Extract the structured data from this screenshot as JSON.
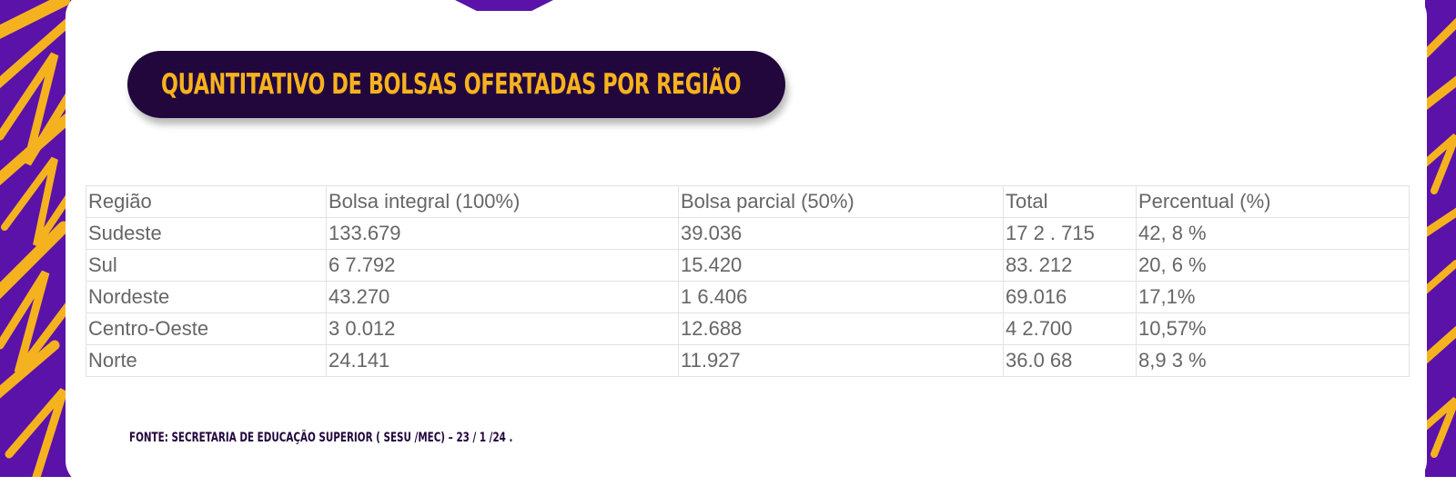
{
  "colors": {
    "accent_purple": "#5b12a8",
    "title_bg": "#22073d",
    "title_text": "#f7b21e",
    "brush_yellow": "#f5b21f",
    "table_text": "#666666",
    "table_border": "#e2e2e2"
  },
  "title": "QUANTITATIVO DE BOLSAS OFERTADAS POR REGIÃO",
  "table": {
    "headers": [
      "Região",
      "Bolsa integral (100%)",
      "Bolsa parcial (50%)",
      "Total",
      "Percentual (%)"
    ],
    "rows": [
      [
        "Sudeste",
        "133.679",
        "39.036",
        "17 2 . 715",
        "42, 8 %"
      ],
      [
        "Sul",
        "6 7.792",
        "15.420",
        "83. 212",
        "20, 6 %"
      ],
      [
        "Nordeste",
        "43.270",
        "1 6.406",
        "69.016",
        "17,1%"
      ],
      [
        "Centro-Oeste",
        "3 0.012",
        "12.688",
        "4 2.700",
        "10,57%"
      ],
      [
        "Norte",
        "24.141",
        "11.927",
        "36.0 68",
        "8,9 3 %"
      ]
    ]
  },
  "source": "FONTE: SECRETARIA DE EDUCAÇÃO SUPERIOR ( SESU /MEC) – 23 / 1 /24 ."
}
